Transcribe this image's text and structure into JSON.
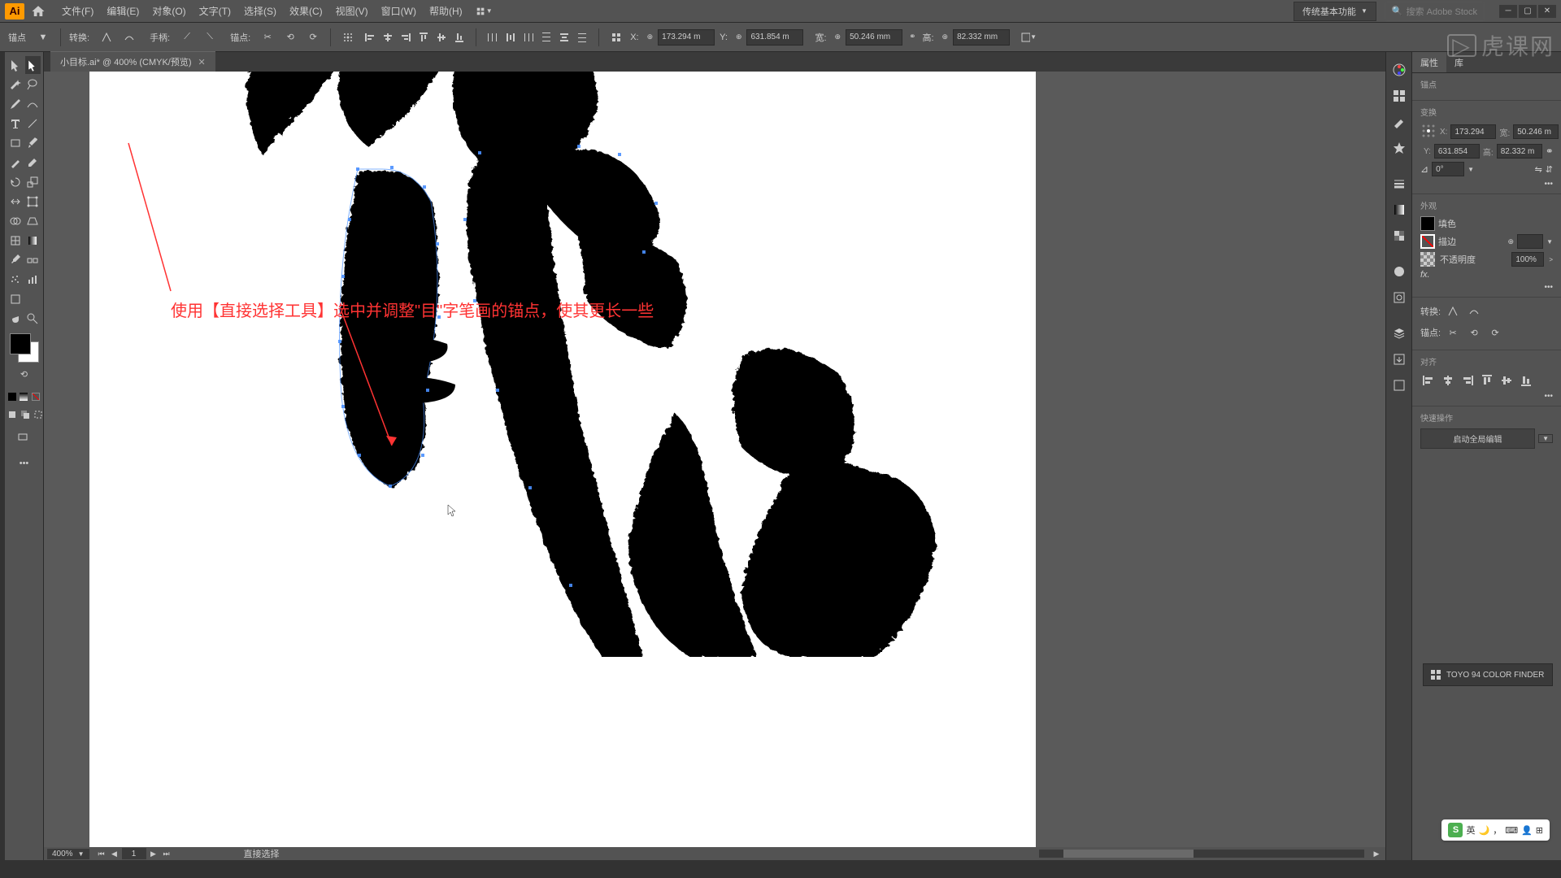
{
  "menubar": {
    "items": [
      "文件(F)",
      "编辑(E)",
      "对象(O)",
      "文字(T)",
      "选择(S)",
      "效果(C)",
      "视图(V)",
      "窗口(W)",
      "帮助(H)"
    ],
    "workspace": "传统基本功能",
    "search_placeholder": "搜索 Adobe Stock"
  },
  "control": {
    "anchor_label": "锚点",
    "convert_label": "转换:",
    "handle_label": "手柄:",
    "anchor2_label": "锚点:",
    "x_label": "X:",
    "y_label": "Y:",
    "w_label": "宽:",
    "h_label": "高:",
    "x": "173.294 m",
    "y": "631.854 m",
    "w": "50.246 mm",
    "h": "82.332 mm"
  },
  "document": {
    "tab_title": "小目标.ai* @ 400% (CMYK/预览)",
    "zoom": "400%",
    "page": "1",
    "tool_name": "直接选择"
  },
  "annotation": "使用【直接选择工具】选中并调整\"目\"字笔画的锚点，使其更长一些",
  "props": {
    "tab1": "属性",
    "tab2": "库",
    "section_anchor": "锚点",
    "section_transform": "变换",
    "x": "173.294",
    "y": "631.854",
    "w": "50.246 m",
    "h": "82.332 m",
    "angle": "0°",
    "section_appearance": "外观",
    "fill_label": "填色",
    "stroke_label": "描边",
    "opacity_label": "不透明度",
    "opacity": "100%",
    "section_convert": "转换:",
    "section_anchors": "锚点:",
    "section_align": "对齐",
    "section_quick": "快速操作",
    "quick_btn": "启动全局编辑"
  },
  "color_finder": "TOYO 94 COLOR FINDER",
  "ime": "英",
  "watermark": "虎课网"
}
